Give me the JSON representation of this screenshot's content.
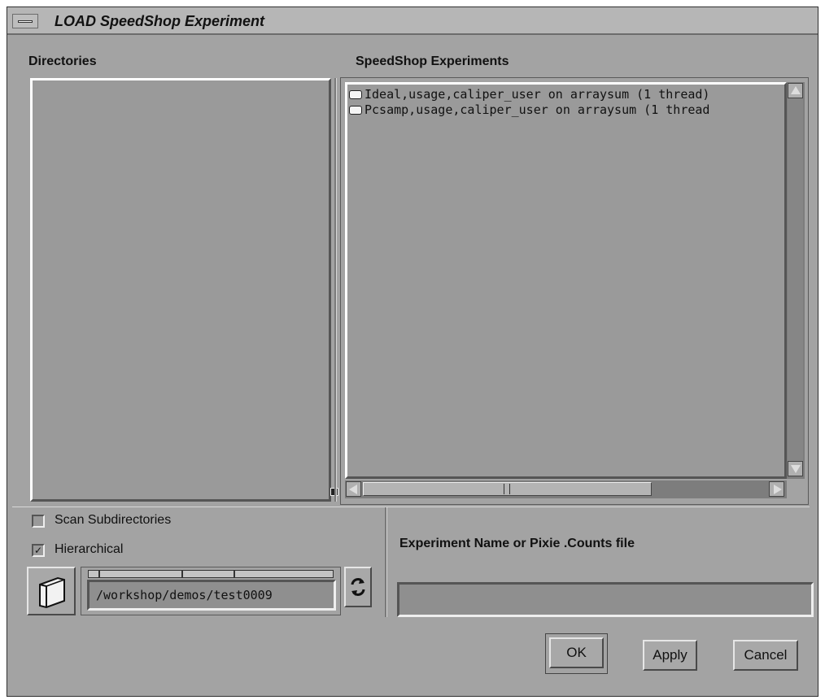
{
  "window": {
    "title": "LOAD SpeedShop Experiment"
  },
  "directories": {
    "label": "Directories",
    "items": []
  },
  "experiments": {
    "label": "SpeedShop Experiments",
    "items": [
      {
        "label": "Ideal,usage,caliper_user on arraysum (1 thread)"
      },
      {
        "label": "Pcsamp,usage,caliper_user on arraysum (1 thread"
      }
    ]
  },
  "options": {
    "scan_subdirectories": {
      "label": "Scan Subdirectories",
      "checked": false
    },
    "hierarchical": {
      "label": "Hierarchical",
      "checked": true
    }
  },
  "path": {
    "value": "/workshop/demos/test0009"
  },
  "experiment_name": {
    "label": "Experiment Name or Pixie .Counts file",
    "value": ""
  },
  "buttons": {
    "ok": "OK",
    "apply": "Apply",
    "cancel": "Cancel"
  },
  "icons": {
    "menu": "window-menu-icon",
    "folder": "folder-icon",
    "refresh": "refresh-icon"
  }
}
